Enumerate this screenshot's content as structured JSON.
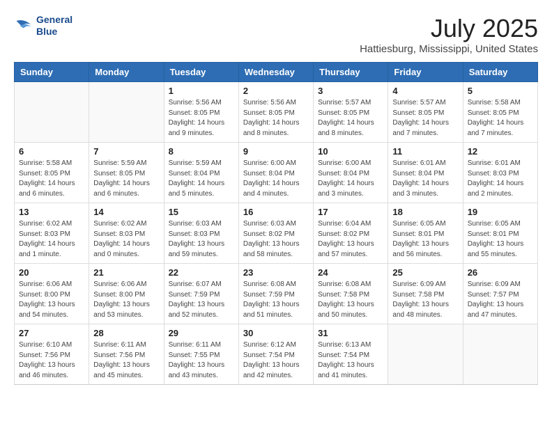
{
  "logo": {
    "line1": "General",
    "line2": "Blue"
  },
  "title": "July 2025",
  "subtitle": "Hattiesburg, Mississippi, United States",
  "headers": [
    "Sunday",
    "Monday",
    "Tuesday",
    "Wednesday",
    "Thursday",
    "Friday",
    "Saturday"
  ],
  "weeks": [
    [
      {
        "day": "",
        "info": ""
      },
      {
        "day": "",
        "info": ""
      },
      {
        "day": "1",
        "info": "Sunrise: 5:56 AM\nSunset: 8:05 PM\nDaylight: 14 hours and 9 minutes."
      },
      {
        "day": "2",
        "info": "Sunrise: 5:56 AM\nSunset: 8:05 PM\nDaylight: 14 hours and 8 minutes."
      },
      {
        "day": "3",
        "info": "Sunrise: 5:57 AM\nSunset: 8:05 PM\nDaylight: 14 hours and 8 minutes."
      },
      {
        "day": "4",
        "info": "Sunrise: 5:57 AM\nSunset: 8:05 PM\nDaylight: 14 hours and 7 minutes."
      },
      {
        "day": "5",
        "info": "Sunrise: 5:58 AM\nSunset: 8:05 PM\nDaylight: 14 hours and 7 minutes."
      }
    ],
    [
      {
        "day": "6",
        "info": "Sunrise: 5:58 AM\nSunset: 8:05 PM\nDaylight: 14 hours and 6 minutes."
      },
      {
        "day": "7",
        "info": "Sunrise: 5:59 AM\nSunset: 8:05 PM\nDaylight: 14 hours and 6 minutes."
      },
      {
        "day": "8",
        "info": "Sunrise: 5:59 AM\nSunset: 8:04 PM\nDaylight: 14 hours and 5 minutes."
      },
      {
        "day": "9",
        "info": "Sunrise: 6:00 AM\nSunset: 8:04 PM\nDaylight: 14 hours and 4 minutes."
      },
      {
        "day": "10",
        "info": "Sunrise: 6:00 AM\nSunset: 8:04 PM\nDaylight: 14 hours and 3 minutes."
      },
      {
        "day": "11",
        "info": "Sunrise: 6:01 AM\nSunset: 8:04 PM\nDaylight: 14 hours and 3 minutes."
      },
      {
        "day": "12",
        "info": "Sunrise: 6:01 AM\nSunset: 8:03 PM\nDaylight: 14 hours and 2 minutes."
      }
    ],
    [
      {
        "day": "13",
        "info": "Sunrise: 6:02 AM\nSunset: 8:03 PM\nDaylight: 14 hours and 1 minute."
      },
      {
        "day": "14",
        "info": "Sunrise: 6:02 AM\nSunset: 8:03 PM\nDaylight: 14 hours and 0 minutes."
      },
      {
        "day": "15",
        "info": "Sunrise: 6:03 AM\nSunset: 8:03 PM\nDaylight: 13 hours and 59 minutes."
      },
      {
        "day": "16",
        "info": "Sunrise: 6:03 AM\nSunset: 8:02 PM\nDaylight: 13 hours and 58 minutes."
      },
      {
        "day": "17",
        "info": "Sunrise: 6:04 AM\nSunset: 8:02 PM\nDaylight: 13 hours and 57 minutes."
      },
      {
        "day": "18",
        "info": "Sunrise: 6:05 AM\nSunset: 8:01 PM\nDaylight: 13 hours and 56 minutes."
      },
      {
        "day": "19",
        "info": "Sunrise: 6:05 AM\nSunset: 8:01 PM\nDaylight: 13 hours and 55 minutes."
      }
    ],
    [
      {
        "day": "20",
        "info": "Sunrise: 6:06 AM\nSunset: 8:00 PM\nDaylight: 13 hours and 54 minutes."
      },
      {
        "day": "21",
        "info": "Sunrise: 6:06 AM\nSunset: 8:00 PM\nDaylight: 13 hours and 53 minutes."
      },
      {
        "day": "22",
        "info": "Sunrise: 6:07 AM\nSunset: 7:59 PM\nDaylight: 13 hours and 52 minutes."
      },
      {
        "day": "23",
        "info": "Sunrise: 6:08 AM\nSunset: 7:59 PM\nDaylight: 13 hours and 51 minutes."
      },
      {
        "day": "24",
        "info": "Sunrise: 6:08 AM\nSunset: 7:58 PM\nDaylight: 13 hours and 50 minutes."
      },
      {
        "day": "25",
        "info": "Sunrise: 6:09 AM\nSunset: 7:58 PM\nDaylight: 13 hours and 48 minutes."
      },
      {
        "day": "26",
        "info": "Sunrise: 6:09 AM\nSunset: 7:57 PM\nDaylight: 13 hours and 47 minutes."
      }
    ],
    [
      {
        "day": "27",
        "info": "Sunrise: 6:10 AM\nSunset: 7:56 PM\nDaylight: 13 hours and 46 minutes."
      },
      {
        "day": "28",
        "info": "Sunrise: 6:11 AM\nSunset: 7:56 PM\nDaylight: 13 hours and 45 minutes."
      },
      {
        "day": "29",
        "info": "Sunrise: 6:11 AM\nSunset: 7:55 PM\nDaylight: 13 hours and 43 minutes."
      },
      {
        "day": "30",
        "info": "Sunrise: 6:12 AM\nSunset: 7:54 PM\nDaylight: 13 hours and 42 minutes."
      },
      {
        "day": "31",
        "info": "Sunrise: 6:13 AM\nSunset: 7:54 PM\nDaylight: 13 hours and 41 minutes."
      },
      {
        "day": "",
        "info": ""
      },
      {
        "day": "",
        "info": ""
      }
    ]
  ]
}
